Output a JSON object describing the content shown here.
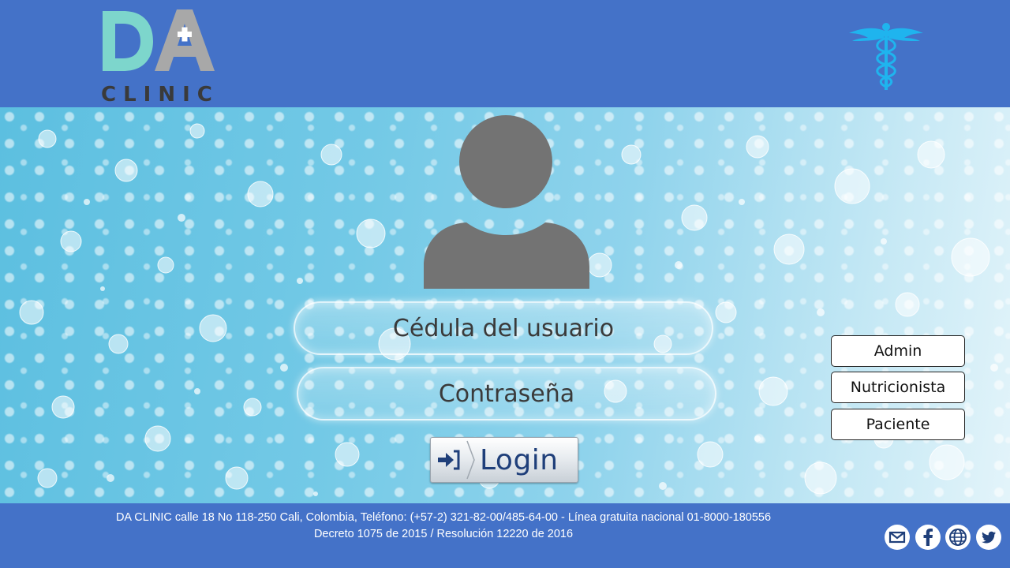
{
  "header": {
    "logo": {
      "letters": "DA",
      "wordmark": "CLINIC"
    },
    "emblem_icon": "caduceus-icon",
    "colors": {
      "background": "#4472c8",
      "logo_teal": "#7dd6cc",
      "logo_grey": "#a8a8a8",
      "emblem": "#1fb4ee"
    }
  },
  "login": {
    "avatar_icon": "user-silhouette-icon",
    "user_placeholder": "Cédula del usuario",
    "password_placeholder": "Contraseña",
    "login_label": "Login",
    "login_icon": "sign-in-icon"
  },
  "roles": {
    "admin": "Admin",
    "nutricionista": "Nutricionista",
    "paciente": "Paciente"
  },
  "footer": {
    "line1": "DA CLINIC calle 18 No 118-250 Cali, Colombia, Teléfono:  (+57-2) 321-82-00/485-64-00 - Línea gratuita nacional  01-8000-180556",
    "line2": "Decreto 1075 de 2015 / Resolución  12220 de 2016",
    "social_icons": [
      "mail-icon",
      "facebook-icon",
      "globe-icon",
      "twitter-icon"
    ]
  }
}
